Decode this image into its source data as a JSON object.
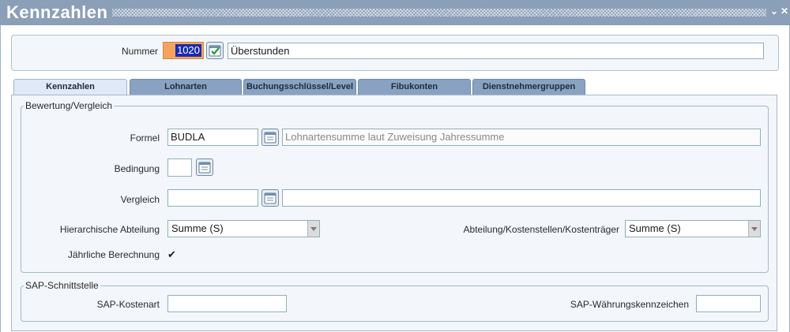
{
  "window": {
    "title": "Kennzahlen",
    "minimize_glyph": "⌄",
    "close_glyph": "✕"
  },
  "header": {
    "nummer_label": "Nummer",
    "nummer_value": "1020",
    "confirm_icon": "check-icon",
    "description_value": "Überstunden"
  },
  "tabs": [
    {
      "label": "Kennzahlen",
      "active": true
    },
    {
      "label": "Lohnarten",
      "active": false
    },
    {
      "label": "Buchungsschlüssel/Level",
      "active": false
    },
    {
      "label": "Fibukonten",
      "active": false
    },
    {
      "label": "Dienstnehmergruppen",
      "active": false
    }
  ],
  "bewertung": {
    "legend": "Bewertung/Vergleich",
    "formel_label": "Formel",
    "formel_value": "BUDLA",
    "formel_description": "Lohnartensumme laut Zuweisung Jahressumme",
    "bedingung_label": "Bedingung",
    "bedingung_value": "",
    "vergleich_label": "Vergleich",
    "vergleich_value": "",
    "vergleich_description": "",
    "hierarchische_label": "Hierarchische Abteilung",
    "hierarchische_value": "Summe (S)",
    "abteilung_label": "Abteilung/Kostenstellen/Kostenträger",
    "abteilung_value": "Summe (S)",
    "jaehrliche_label": "Jährliche Berechnung",
    "jaehrliche_checked": "✔"
  },
  "sap": {
    "legend": "SAP-Schnittstelle",
    "kostenart_label": "SAP-Kostenart",
    "kostenart_value": "",
    "waehrung_label": "SAP-Währungskennzeichen",
    "waehrung_value": ""
  },
  "colors": {
    "titlebar": "#8c9fb8",
    "tab_inactive": "#8aa2c2",
    "tab_active": "#dfe9f7",
    "nummer_highlight": "#f5a35a",
    "selection": "#1b2ab0"
  }
}
